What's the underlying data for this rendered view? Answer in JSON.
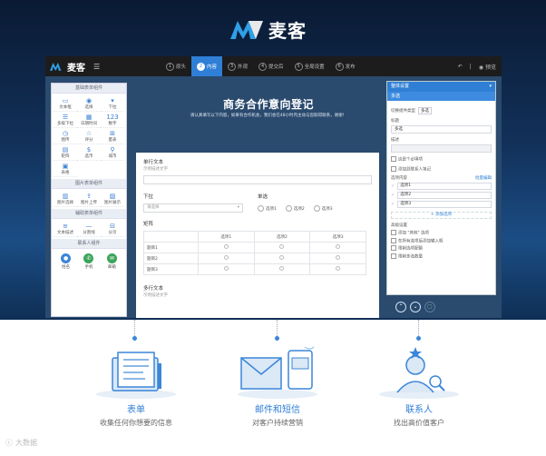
{
  "brand": {
    "name": "麦客"
  },
  "toolbar": {
    "brand": "麦客",
    "steps": [
      {
        "num": "1",
        "label": "原头"
      },
      {
        "num": "2",
        "label": "内容"
      },
      {
        "num": "3",
        "label": "外观"
      },
      {
        "num": "4",
        "label": "提交后"
      },
      {
        "num": "5",
        "label": "全局设置"
      },
      {
        "num": "6",
        "label": "发布"
      }
    ],
    "preview": "预览"
  },
  "left_panel": {
    "section1_title": "基础表单组件",
    "section1_items": [
      {
        "icon": "▭",
        "label": "文本框"
      },
      {
        "icon": "◉",
        "label": "选择"
      },
      {
        "icon": "▾",
        "label": "下拉"
      },
      {
        "icon": "☰",
        "label": "多级下拉"
      },
      {
        "icon": "▦",
        "label": "日期时间"
      },
      {
        "icon": "123",
        "label": "数字"
      },
      {
        "icon": "◷",
        "label": "图传"
      },
      {
        "icon": "☆",
        "label": "评分"
      },
      {
        "icon": "⊞",
        "label": "量表"
      },
      {
        "icon": "▤",
        "label": "矩阵"
      },
      {
        "icon": "$",
        "label": "选币"
      },
      {
        "icon": "⚲",
        "label": "城市"
      },
      {
        "icon": "▣",
        "label": "表格"
      }
    ],
    "section2_title": "图片表单组件",
    "section2_items": [
      {
        "icon": "▥",
        "label": "图片选择"
      },
      {
        "icon": "⇪",
        "label": "图片上传"
      },
      {
        "icon": "▨",
        "label": "图片展示"
      }
    ],
    "section3_title": "辅助表单组件",
    "section3_items": [
      {
        "icon": "≡",
        "label": "文本描述"
      },
      {
        "icon": "—",
        "label": "分割线"
      },
      {
        "icon": "⊟",
        "label": "分页"
      }
    ],
    "section4_title": "联系人组件",
    "section4_items": [
      {
        "icon": "●",
        "label": "姓名",
        "color": "#3a86d8"
      },
      {
        "icon": "✆",
        "label": "手机",
        "color": "#3aa55a"
      },
      {
        "icon": "✉",
        "label": "邮箱",
        "color": "#3aa55a"
      }
    ]
  },
  "form": {
    "title": "商务合作意向登记",
    "subtitle": "请认真填写以下内容，如果有合作机会，我们会在48小时内主动与您取得联系，谢谢！",
    "field1_label": "单行文本",
    "field1_hint": "示例描述文字",
    "dropdown_label": "下拉",
    "dropdown_placeholder": "请选择",
    "radio_label": "单选",
    "radio_options": [
      "选项1",
      "选项2",
      "选项3"
    ],
    "matrix_label": "矩阵",
    "matrix_cols": [
      "选项1",
      "选项2",
      "选项3"
    ],
    "matrix_rows": [
      "题目1",
      "题目2",
      "题目3"
    ],
    "multiline_label": "多行文本",
    "multiline_hint": "示例描述文字"
  },
  "right_panel": {
    "header": "整体设置",
    "tab": "多选",
    "switch_type_label": "切换组件类型",
    "switch_type_value": "多选",
    "title_label": "标题",
    "title_value": "多选",
    "desc_label": "描述",
    "checks": [
      "这是个必填项",
      "添加到联系人笔记"
    ],
    "options_label": "选项内容",
    "batch_edit": "批量编辑",
    "options": [
      "选项1",
      "选项2",
      "选项3"
    ],
    "add_option": "+ 添加选项",
    "advanced_label": "高级设置",
    "advanced_checks": [
      "添加 \"其他\" 选项",
      "在所有选项后添加输入框",
      "限制选项配额",
      "限制多选数量"
    ]
  },
  "features": [
    {
      "title": "表单",
      "desc": "收集任何你想要的信息"
    },
    {
      "title": "邮件和短信",
      "desc": "对客户持续营销"
    },
    {
      "title": "联系人",
      "desc": "找出高价值客户"
    }
  ],
  "watermark": "大数据",
  "colors": {
    "accent": "#2f7fd6",
    "topbar": "#1c1c1c",
    "hero": "#12315a"
  }
}
